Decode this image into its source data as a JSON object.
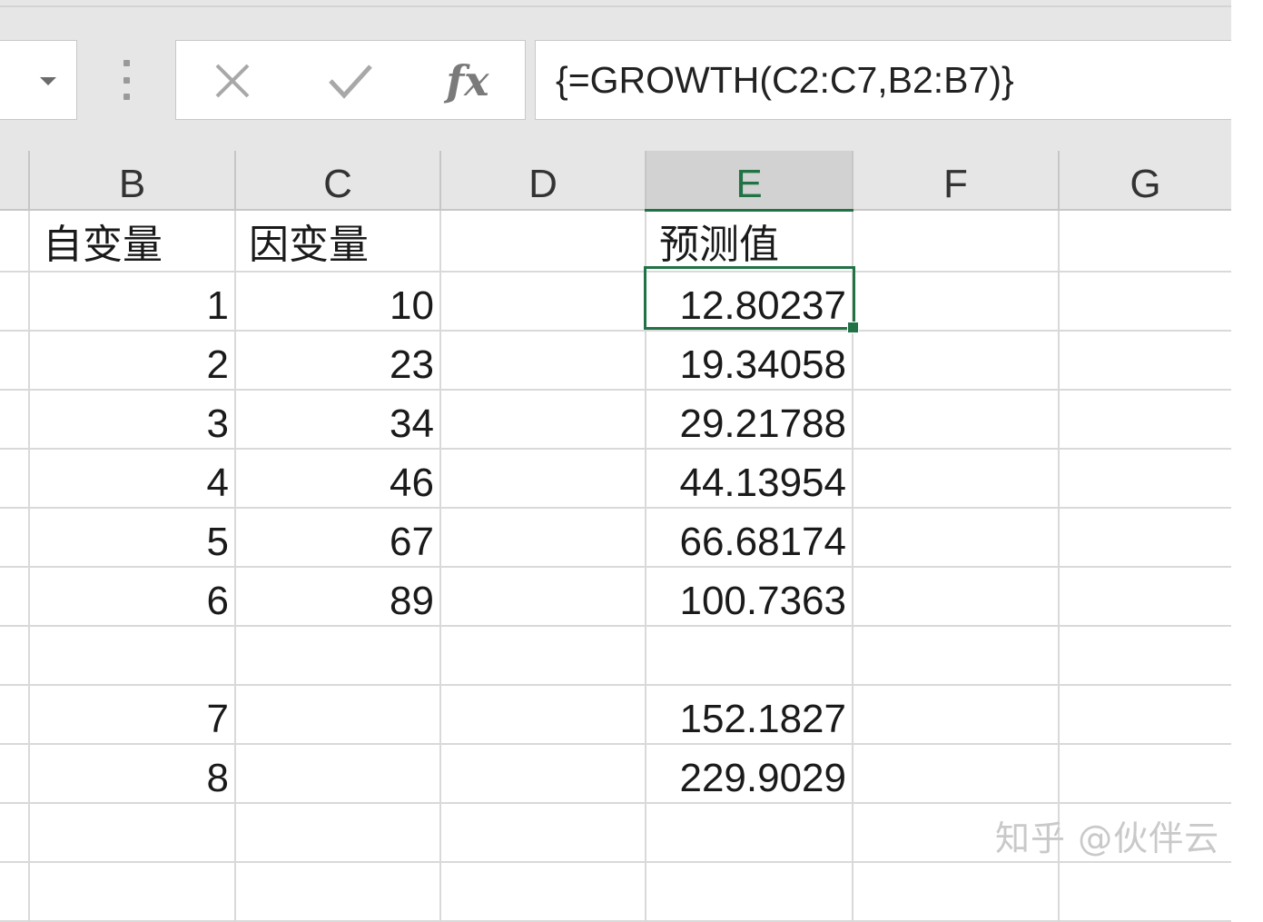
{
  "formula_bar": {
    "formula": "{=GROWTH(C2:C7,B2:B7)}",
    "fx_label": "fx"
  },
  "columns": [
    "B",
    "C",
    "D",
    "E",
    "F",
    "G"
  ],
  "selected_column": "E",
  "rows": [
    {
      "B": "自变量",
      "C": "因变量",
      "D": "",
      "E": "预测值"
    },
    {
      "B": "1",
      "C": "10",
      "D": "",
      "E": "12.80237"
    },
    {
      "B": "2",
      "C": "23",
      "D": "",
      "E": "19.34058"
    },
    {
      "B": "3",
      "C": "34",
      "D": "",
      "E": "29.21788"
    },
    {
      "B": "4",
      "C": "46",
      "D": "",
      "E": "44.13954"
    },
    {
      "B": "5",
      "C": "67",
      "D": "",
      "E": "66.68174"
    },
    {
      "B": "6",
      "C": "89",
      "D": "",
      "E": "100.7363"
    },
    {
      "B": "",
      "C": "",
      "D": "",
      "E": ""
    },
    {
      "B": "7",
      "C": "",
      "D": "",
      "E": "152.1827"
    },
    {
      "B": "8",
      "C": "",
      "D": "",
      "E": "229.9029"
    },
    {
      "B": "",
      "C": "",
      "D": "",
      "E": ""
    },
    {
      "B": "",
      "C": "",
      "D": "",
      "E": ""
    }
  ],
  "watermark": "知乎 @伙伴云",
  "colors": {
    "accent": "#217346",
    "header_bg": "#e6e6e6",
    "gridline": "#d9d9d9"
  }
}
